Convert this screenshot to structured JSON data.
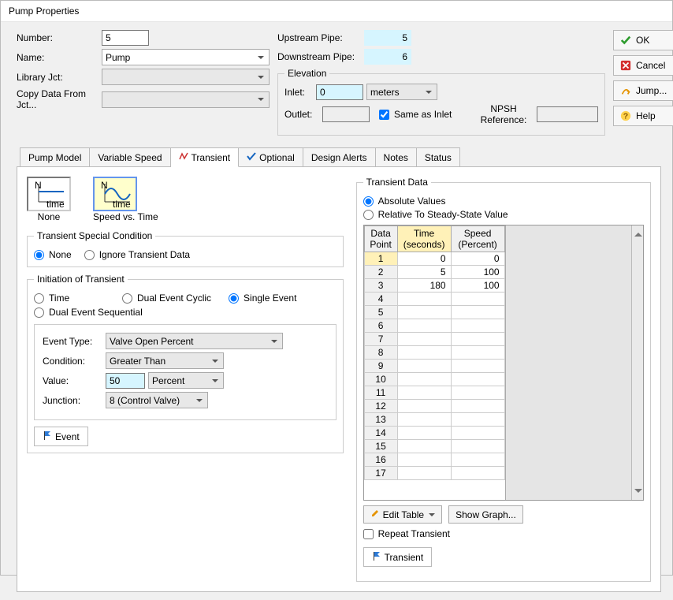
{
  "window": {
    "title": "Pump Properties"
  },
  "form": {
    "number_label": "Number:",
    "number": "5",
    "name_label": "Name:",
    "name": "Pump",
    "library_label": "Library Jct:",
    "library": "",
    "copy_label": "Copy Data From Jct...",
    "copy": ""
  },
  "pipes": {
    "upstream_label": "Upstream Pipe:",
    "upstream": "5",
    "downstream_label": "Downstream Pipe:",
    "downstream": "6"
  },
  "elevation": {
    "legend": "Elevation",
    "inlet_label": "Inlet:",
    "inlet": "0",
    "inlet_units": "meters",
    "outlet_label": "Outlet:",
    "same_as_inlet_label": "Same as Inlet",
    "npsh_label": "NPSH Reference:",
    "npsh": ""
  },
  "buttons": {
    "ok": "OK",
    "cancel": "Cancel",
    "jump": "Jump...",
    "help": "Help"
  },
  "tabs": {
    "pump_model": "Pump Model",
    "variable_speed": "Variable Speed",
    "transient": "Transient",
    "optional": "Optional",
    "design_alerts": "Design Alerts",
    "notes": "Notes",
    "status": "Status"
  },
  "ttype": {
    "none": "None",
    "speed_vs_time": "Speed vs. Time"
  },
  "tsc": {
    "legend": "Transient Special Condition",
    "none": "None",
    "ignore": "Ignore Transient Data"
  },
  "init": {
    "legend": "Initiation of Transient",
    "time": "Time",
    "single": "Single Event",
    "dual_cyclic": "Dual Event Cyclic",
    "dual_seq": "Dual Event Sequential",
    "event_type_label": "Event Type:",
    "event_type": "Valve Open Percent",
    "condition_label": "Condition:",
    "condition": "Greater Than",
    "value_label": "Value:",
    "value": "50",
    "value_units": "Percent",
    "junction_label": "Junction:",
    "junction": "8 (Control Valve)",
    "event_tab": "Event"
  },
  "tdata": {
    "legend": "Transient Data",
    "absolute": "Absolute Values",
    "relative": "Relative To Steady-State Value",
    "headers": {
      "dp": "Data Point",
      "time": "Time (seconds)",
      "speed": "Speed (Percent)"
    },
    "edit_table": "Edit Table",
    "show_graph": "Show Graph...",
    "repeat": "Repeat Transient",
    "transient_tab": "Transient"
  },
  "chart_data": {
    "type": "table",
    "title": "Transient Data",
    "columns": [
      "Data Point",
      "Time (seconds)",
      "Speed (Percent)"
    ],
    "rows": [
      {
        "dp": 1,
        "time": 0,
        "speed": 0
      },
      {
        "dp": 2,
        "time": 5,
        "speed": 100
      },
      {
        "dp": 3,
        "time": 180,
        "speed": 100
      },
      {
        "dp": 4,
        "time": "",
        "speed": ""
      },
      {
        "dp": 5,
        "time": "",
        "speed": ""
      },
      {
        "dp": 6,
        "time": "",
        "speed": ""
      },
      {
        "dp": 7,
        "time": "",
        "speed": ""
      },
      {
        "dp": 8,
        "time": "",
        "speed": ""
      },
      {
        "dp": 9,
        "time": "",
        "speed": ""
      },
      {
        "dp": 10,
        "time": "",
        "speed": ""
      },
      {
        "dp": 11,
        "time": "",
        "speed": ""
      },
      {
        "dp": 12,
        "time": "",
        "speed": ""
      },
      {
        "dp": 13,
        "time": "",
        "speed": ""
      },
      {
        "dp": 14,
        "time": "",
        "speed": ""
      },
      {
        "dp": 15,
        "time": "",
        "speed": ""
      },
      {
        "dp": 16,
        "time": "",
        "speed": ""
      },
      {
        "dp": 17,
        "time": "",
        "speed": ""
      }
    ]
  }
}
